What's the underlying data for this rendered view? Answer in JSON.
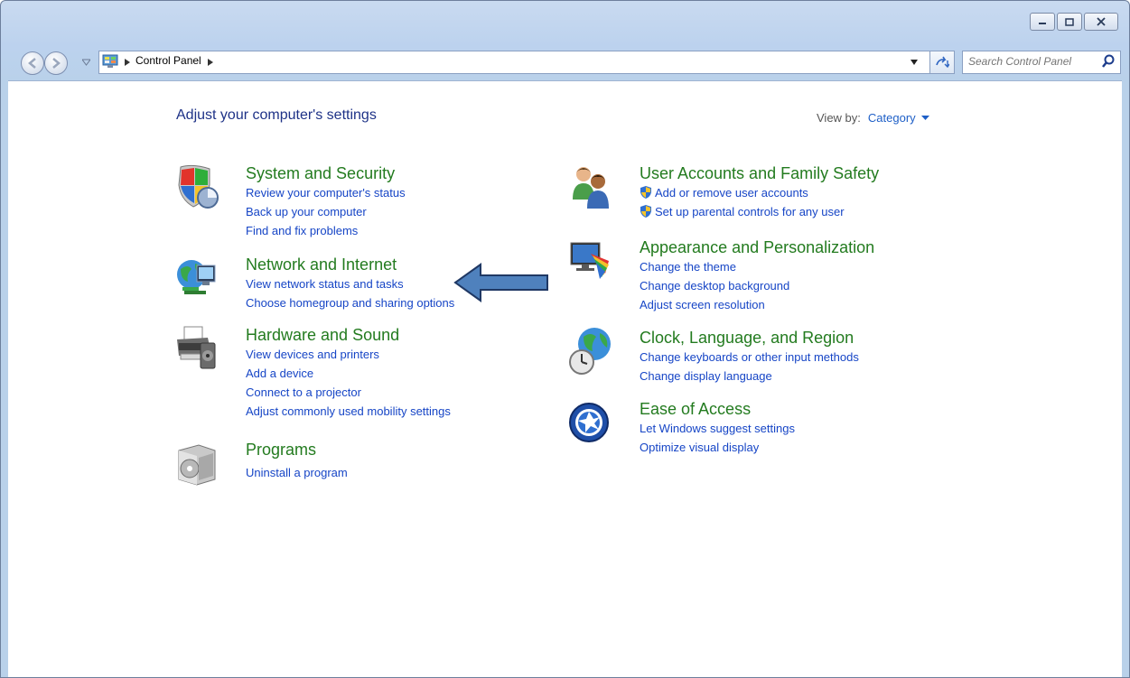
{
  "window": {
    "controls": {
      "minimize": "minimize-icon",
      "maximize": "maximize-icon",
      "close": "close-icon"
    }
  },
  "toolbar": {
    "breadcrumb": {
      "root": "Control Panel"
    },
    "search": {
      "placeholder": "Search Control Panel"
    }
  },
  "main": {
    "heading": "Adjust your computer's settings",
    "view_by": {
      "label": "View by:",
      "value": "Category"
    },
    "left": [
      {
        "title": "System and Security",
        "icon": "shield-icon",
        "links": [
          "Review your computer's status",
          "Back up your computer",
          "Find and fix problems"
        ]
      },
      {
        "title": "Network and Internet",
        "icon": "network-globe-icon",
        "links": [
          "View network status and tasks",
          "Choose homegroup and sharing options"
        ]
      },
      {
        "title": "Hardware and Sound",
        "icon": "printer-speaker-icon",
        "links": [
          "View devices and printers",
          "Add a device",
          "Connect to a projector",
          "Adjust commonly used mobility settings"
        ]
      },
      {
        "title": "Programs",
        "icon": "programs-box-icon",
        "links": [
          "Uninstall a program"
        ]
      }
    ],
    "right": [
      {
        "title": "User Accounts and Family Safety",
        "icon": "users-icon",
        "links": [
          "Add or remove user accounts",
          "Set up parental controls for any user"
        ]
      },
      {
        "title": "Appearance and Personalization",
        "icon": "monitor-palette-icon",
        "links": [
          "Change the theme",
          "Change desktop background",
          "Adjust screen resolution"
        ]
      },
      {
        "title": "Clock, Language, and Region",
        "icon": "clock-globe-icon",
        "links": [
          "Change keyboards or other input methods",
          "Change display language"
        ]
      },
      {
        "title": "Ease of Access",
        "icon": "ease-of-access-icon",
        "links": [
          "Let Windows suggest settings",
          "Optimize visual display"
        ]
      }
    ]
  },
  "annotation": {
    "arrow_color": "#4f81bd",
    "arrow_border": "#1f3864"
  }
}
